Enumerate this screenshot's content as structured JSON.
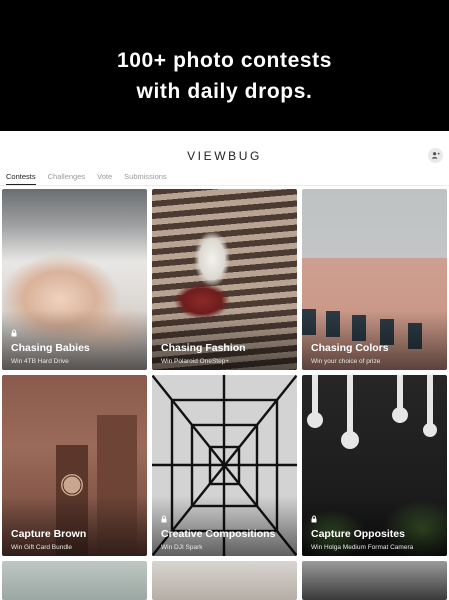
{
  "promo": {
    "line1": "100+ photo contests",
    "line2": "with daily drops."
  },
  "header": {
    "brand": "VIEWBUG",
    "invite_icon": "add-user-icon"
  },
  "tabs": [
    {
      "label": "Contests",
      "active": true
    },
    {
      "label": "Challenges",
      "active": false
    },
    {
      "label": "Vote",
      "active": false
    },
    {
      "label": "Submissions",
      "active": false
    }
  ],
  "contests": [
    {
      "title": "Chasing Babies",
      "prize": "Win 4TB Hard Drive",
      "locked": true
    },
    {
      "title": "Chasing Fashion",
      "prize": "Win Polaroid OneStep+",
      "locked": false
    },
    {
      "title": "Chasing Colors",
      "prize": "Win your choice of prize",
      "locked": false
    },
    {
      "title": "Capture Brown",
      "prize": "Win Gift Card Bundle",
      "locked": false
    },
    {
      "title": "Creative Compositions",
      "prize": "Win DJI Spark",
      "locked": true
    },
    {
      "title": "Capture Opposites",
      "prize": "Win Holga Medium Format Camera",
      "locked": true
    }
  ],
  "colors": {
    "accent": "#222222",
    "promo_bg": "#000000"
  }
}
